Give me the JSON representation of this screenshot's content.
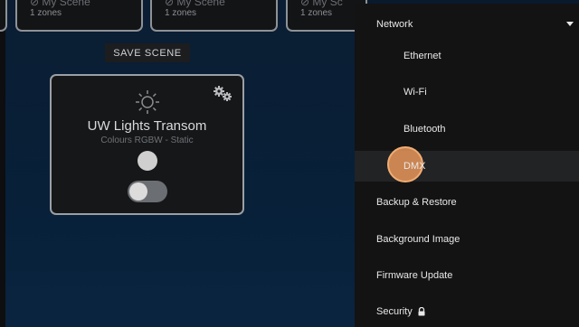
{
  "scenes": [
    {
      "zones": "1 zones"
    },
    {
      "zones": "1 zones"
    },
    {
      "zones": "1 zones"
    }
  ],
  "save_scene_label": "SAVE SCENE",
  "light_card": {
    "title": "UW Lights Transom",
    "subtitle": "Colours RGBW - Static",
    "dot_color": "#cfcfcf",
    "toggle_state": "off",
    "icons": [
      "sun-icon",
      "gear-icon"
    ]
  },
  "menu": {
    "network": "Network",
    "ethernet": "Ethernet",
    "wifi": "Wi-Fi",
    "bluetooth": "Bluetooth",
    "dmx": "DMX",
    "backup": "Backup & Restore",
    "background": "Background Image",
    "firmware": "Firmware Update",
    "security": "Security"
  },
  "colors": {
    "background": "#0a1a2e",
    "menu_bg": "#131313",
    "ripple": "#e8965a"
  }
}
